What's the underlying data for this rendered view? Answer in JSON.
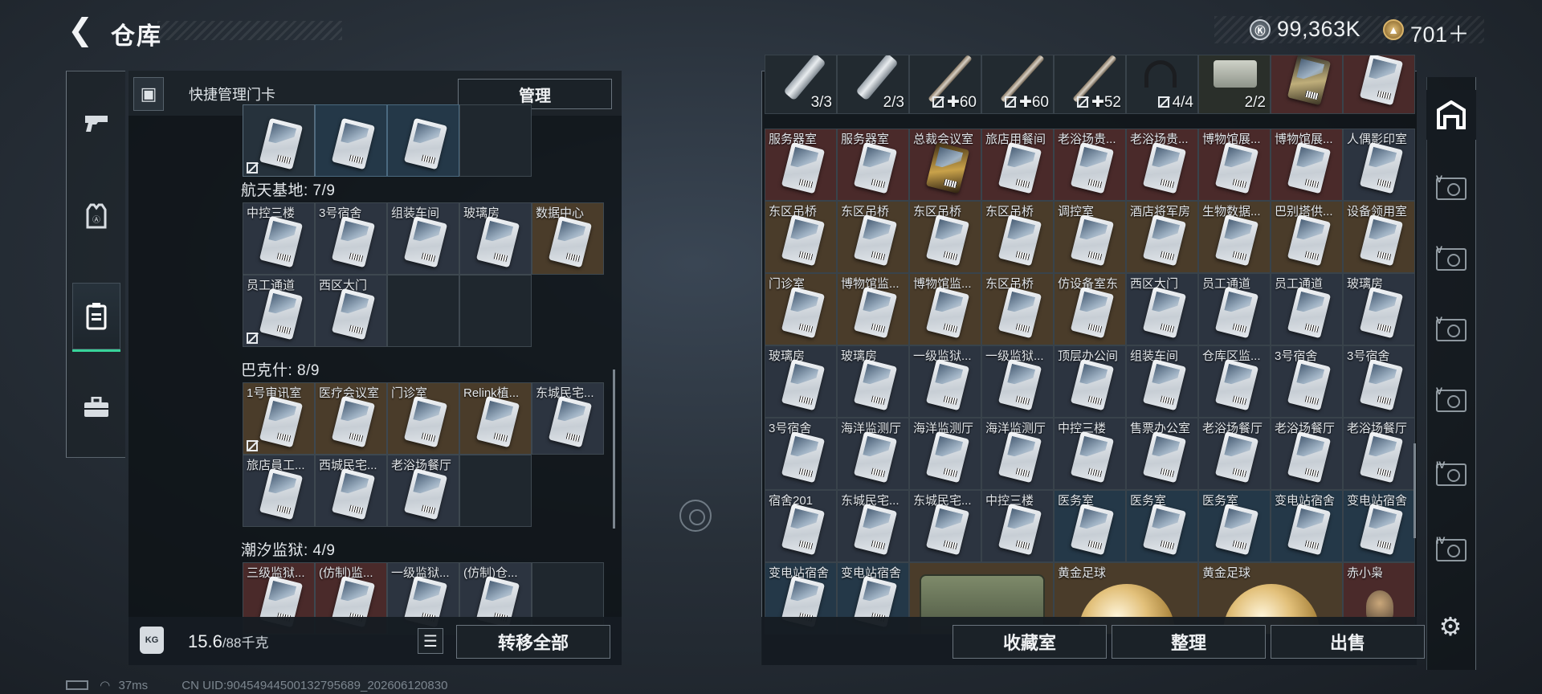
{
  "header": {
    "title": "仓库",
    "back_icon": "back-arrow-icon"
  },
  "currency": [
    {
      "icon": "silver-coin-icon",
      "value": "99,363K"
    },
    {
      "icon": "gold-coin-icon",
      "value": "701＋"
    }
  ],
  "left_nav": [
    {
      "name": "weapons",
      "icon": "pistol-icon",
      "active": false
    },
    {
      "name": "armor",
      "icon": "vest-icon",
      "active": false
    },
    {
      "name": "keycards",
      "icon": "keycard-icon",
      "active": true
    },
    {
      "name": "toolbox",
      "icon": "toolbox-icon",
      "active": false
    }
  ],
  "left_panel": {
    "header_label": "快捷管理门卡",
    "manage_label": "管理",
    "top_row": [
      {
        "name": "",
        "border": "#5a6d7c",
        "bg": "#26323c",
        "nomark": true
      },
      {
        "name": "",
        "border": "#4b6a80",
        "bg": "#243848",
        "nomark": false
      },
      {
        "name": "",
        "border": "#4b6a80",
        "bg": "#243848",
        "nomark": false
      },
      {
        "name": "",
        "border": "#3e4850",
        "bg": "#1f272e",
        "nomark": false,
        "empty": true
      }
    ],
    "groups": [
      {
        "title": "航天基地: 7/9",
        "cells": [
          {
            "name": "中控三楼",
            "bg": "#2c3440"
          },
          {
            "name": "3号宿舍",
            "bg": "#2c3440"
          },
          {
            "name": "组装车间",
            "bg": "#2c3440"
          },
          {
            "name": "玻璃房",
            "bg": "#2c3440"
          },
          {
            "name": "数据中心",
            "bg": "#4a3c2a"
          },
          {
            "name": "员工通道",
            "bg": "#2c3440",
            "nomark": true
          },
          {
            "name": "西区大门",
            "bg": "#2c3440"
          },
          {
            "name": "",
            "bg": "#1f272e",
            "empty": true
          },
          {
            "name": "",
            "bg": "#1f272e",
            "empty": true
          }
        ]
      },
      {
        "title": "巴克什: 8/9",
        "cells": [
          {
            "name": "1号审讯室",
            "bg": "#4a3c2a",
            "nomark": true
          },
          {
            "name": "医疗会议室",
            "bg": "#4a3c2a"
          },
          {
            "name": "门诊室",
            "bg": "#4a3c2a"
          },
          {
            "name": "Relink植...",
            "bg": "#4a3c2a"
          },
          {
            "name": "东城民宅...",
            "bg": "#2c3440"
          },
          {
            "name": "旅店員工...",
            "bg": "#2c3440"
          },
          {
            "name": "西城民宅...",
            "bg": "#2c3440"
          },
          {
            "name": "老浴场餐厅",
            "bg": "#2c3440"
          },
          {
            "name": "",
            "bg": "#1f272e",
            "empty": true
          }
        ]
      },
      {
        "title": "潮汐监狱: 4/9",
        "cells": [
          {
            "name": "三级监狱...",
            "bg": "#4a2a2a"
          },
          {
            "name": "(仿制)监...",
            "bg": "#4a2a2a"
          },
          {
            "name": "一级监狱...",
            "bg": "#2c3440"
          },
          {
            "name": "(仿制)仓...",
            "bg": "#2c3440"
          },
          {
            "name": "",
            "bg": "#1f272e",
            "empty": true
          }
        ]
      }
    ],
    "weight": "15.6",
    "weight_max": "/88千克",
    "transfer_label": "转移全部"
  },
  "right_panel": {
    "top_row": [
      {
        "type": "tube",
        "count": "3/3",
        "nomark": false,
        "bg": "#222a30"
      },
      {
        "type": "tube",
        "count": "2/3",
        "nomark": false,
        "bg": "#222a30"
      },
      {
        "type": "sticker",
        "count": "✚60",
        "nomark": true,
        "bg": "#222a30"
      },
      {
        "type": "sticker",
        "count": "✚60",
        "nomark": true,
        "bg": "#222a30"
      },
      {
        "type": "sticker",
        "count": "✚52",
        "nomark": true,
        "bg": "#222a30"
      },
      {
        "type": "headset",
        "count": "4/4",
        "nomark": true,
        "bg": "#222a30"
      },
      {
        "type": "bag",
        "count": "2/2",
        "nomark": false,
        "bg": "#2a2f2a"
      },
      {
        "type": "card",
        "count": "",
        "nomark": false,
        "bg": "#4a2a2a"
      },
      {
        "type": "card",
        "count": "",
        "nomark": false,
        "bg": "#4a2a2a"
      }
    ],
    "rows": [
      [
        {
          "name": "服务器室",
          "bg": "#4a2a2a"
        },
        {
          "name": "服务器室",
          "bg": "#4a2a2a"
        },
        {
          "name": "总裁会议室",
          "bg": "#4a2a2a",
          "dark": true
        },
        {
          "name": "旅店用餐间",
          "bg": "#4a2a2a"
        },
        {
          "name": "老浴场贵...",
          "bg": "#4a2a2a"
        },
        {
          "name": "老浴场贵...",
          "bg": "#4a2a2a"
        },
        {
          "name": "博物馆展...",
          "bg": "#4a2a2a"
        },
        {
          "name": "博物馆展...",
          "bg": "#4a2a2a"
        },
        {
          "name": "人偶影印室",
          "bg": "#2c3440"
        }
      ],
      [
        {
          "name": "东区吊桥",
          "bg": "#4a3c2a"
        },
        {
          "name": "东区吊桥",
          "bg": "#4a3c2a"
        },
        {
          "name": "东区吊桥",
          "bg": "#4a3c2a"
        },
        {
          "name": "东区吊桥",
          "bg": "#4a3c2a"
        },
        {
          "name": "调控室",
          "bg": "#4a3c2a"
        },
        {
          "name": "酒店将军房",
          "bg": "#4a3c2a"
        },
        {
          "name": "生物数据...",
          "bg": "#4a3c2a"
        },
        {
          "name": "巴别塔供...",
          "bg": "#4a3c2a"
        },
        {
          "name": "设备领用室",
          "bg": "#4a3c2a"
        }
      ],
      [
        {
          "name": "门诊室",
          "bg": "#4a3c2a"
        },
        {
          "name": "博物馆监...",
          "bg": "#4a3c2a"
        },
        {
          "name": "博物馆监...",
          "bg": "#4a3c2a"
        },
        {
          "name": "东区吊桥",
          "bg": "#4a3c2a"
        },
        {
          "name": "仿设备室东",
          "bg": "#4a3c2a"
        },
        {
          "name": "西区大门",
          "bg": "#2c3440"
        },
        {
          "name": "员工通道",
          "bg": "#2c3440"
        },
        {
          "name": "员工通道",
          "bg": "#2c3440"
        },
        {
          "name": "玻璃房",
          "bg": "#2c3440"
        }
      ],
      [
        {
          "name": "玻璃房",
          "bg": "#2c3440"
        },
        {
          "name": "玻璃房",
          "bg": "#2c3440"
        },
        {
          "name": "一级监狱...",
          "bg": "#2c3440"
        },
        {
          "name": "一级监狱...",
          "bg": "#2c3440"
        },
        {
          "name": "顶层办公间",
          "bg": "#2c3440"
        },
        {
          "name": "组装车间",
          "bg": "#2c3440"
        },
        {
          "name": "仓库区监...",
          "bg": "#2c3440"
        },
        {
          "name": "3号宿舍",
          "bg": "#2c3440"
        },
        {
          "name": "3号宿舍",
          "bg": "#2c3440"
        }
      ],
      [
        {
          "name": "3号宿舍",
          "bg": "#2c3440"
        },
        {
          "name": "海洋监测厅",
          "bg": "#2c3440"
        },
        {
          "name": "海洋监测厅",
          "bg": "#2c3440"
        },
        {
          "name": "海洋监测厅",
          "bg": "#2c3440"
        },
        {
          "name": "中控三楼",
          "bg": "#2c3440"
        },
        {
          "name": "售票办公室",
          "bg": "#2c3440"
        },
        {
          "name": "老浴场餐厅",
          "bg": "#2c3440"
        },
        {
          "name": "老浴场餐厅",
          "bg": "#2c3440"
        },
        {
          "name": "老浴场餐厅",
          "bg": "#2c3440"
        }
      ],
      [
        {
          "name": "宿舍201",
          "bg": "#2c3440"
        },
        {
          "name": "东城民宅...",
          "bg": "#2c3440"
        },
        {
          "name": "东城民宅...",
          "bg": "#2c3440"
        },
        {
          "name": "中控三楼",
          "bg": "#2c3440"
        },
        {
          "name": "医务室",
          "bg": "#243848"
        },
        {
          "name": "医务室",
          "bg": "#243848"
        },
        {
          "name": "医务室",
          "bg": "#243848"
        },
        {
          "name": "变电站宿舍",
          "bg": "#243848"
        },
        {
          "name": "变电站宿舍",
          "bg": "#243848"
        }
      ]
    ],
    "bottom_row": {
      "small": [
        {
          "name": "变电站宿舍",
          "bg": "#243848"
        },
        {
          "name": "变电站宿舍",
          "bg": "#243848"
        }
      ],
      "case_label": "",
      "ball_1": "黄金足球",
      "ball_2": "黄金足球",
      "last": "赤小枭"
    },
    "footer_buttons": [
      "收藏室",
      "整理",
      "出售"
    ]
  },
  "right_nav": [
    {
      "icon": "stash-icon",
      "active": true
    },
    {
      "icon": "vault-V-icon",
      "tag": "V"
    },
    {
      "icon": "vault-V-icon",
      "tag": "V"
    },
    {
      "icon": "vault-V-icon",
      "tag": "V"
    },
    {
      "icon": "vault-V-icon",
      "tag": "V"
    },
    {
      "icon": "vault-IV-icon",
      "tag": "IV"
    },
    {
      "icon": "vault-IV-add-icon",
      "tag": "IV"
    }
  ],
  "status_bar": {
    "ping": "37ms",
    "uid": "CN UID:90454944500132795689_202606120830"
  }
}
